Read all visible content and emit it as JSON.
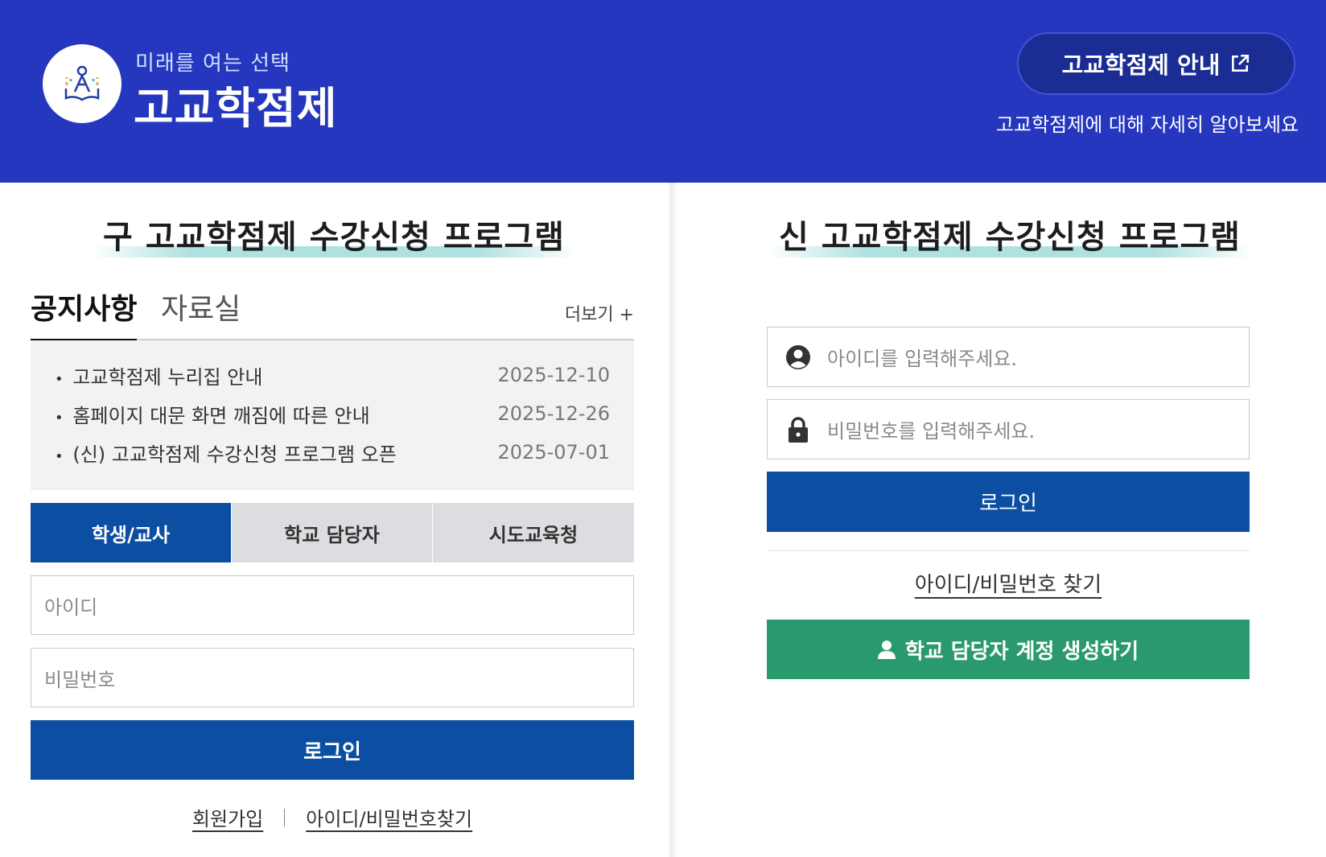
{
  "header": {
    "subtitle": "미래를 여는 선택",
    "title": "고교학점제",
    "guide_button_label": "고교학점제 안내",
    "guide_description": "고교학점제에 대해 자세히 알아보세요"
  },
  "old_program": {
    "title": "구 고교학점제 수강신청 프로그램",
    "tabs": [
      "공지사항",
      "자료실"
    ],
    "more_label": "더보기 +",
    "notices": [
      {
        "title": "고교학점제 누리집 안내",
        "date": "2025-12-10"
      },
      {
        "title": "홈페이지 대문 화면 깨짐에 따른 안내",
        "date": "2025-12-26"
      },
      {
        "title": "(신) 고교학점제 수강신청 프로그램 오픈",
        "date": "2025-07-01"
      }
    ],
    "roles": [
      "학생/교사",
      "학교 담당자",
      "시도교육청"
    ],
    "id_placeholder": "아이디",
    "pw_placeholder": "비밀번호",
    "login_label": "로그인",
    "signup_label": "회원가입",
    "find_label": "아이디/비밀번호찾기"
  },
  "new_program": {
    "title": "신 고교학점제 수강신청 프로그램",
    "id_placeholder": "아이디를 입력해주세요.",
    "pw_placeholder": "비밀번호를 입력해주세요.",
    "login_label": "로그인",
    "find_label": "아이디/비밀번호 찾기",
    "create_account_label": "학교 담당자 계정 생성하기"
  },
  "colors": {
    "header_bg": "#2537bf",
    "primary": "#0c4fa2",
    "green": "#2a9a6e"
  }
}
